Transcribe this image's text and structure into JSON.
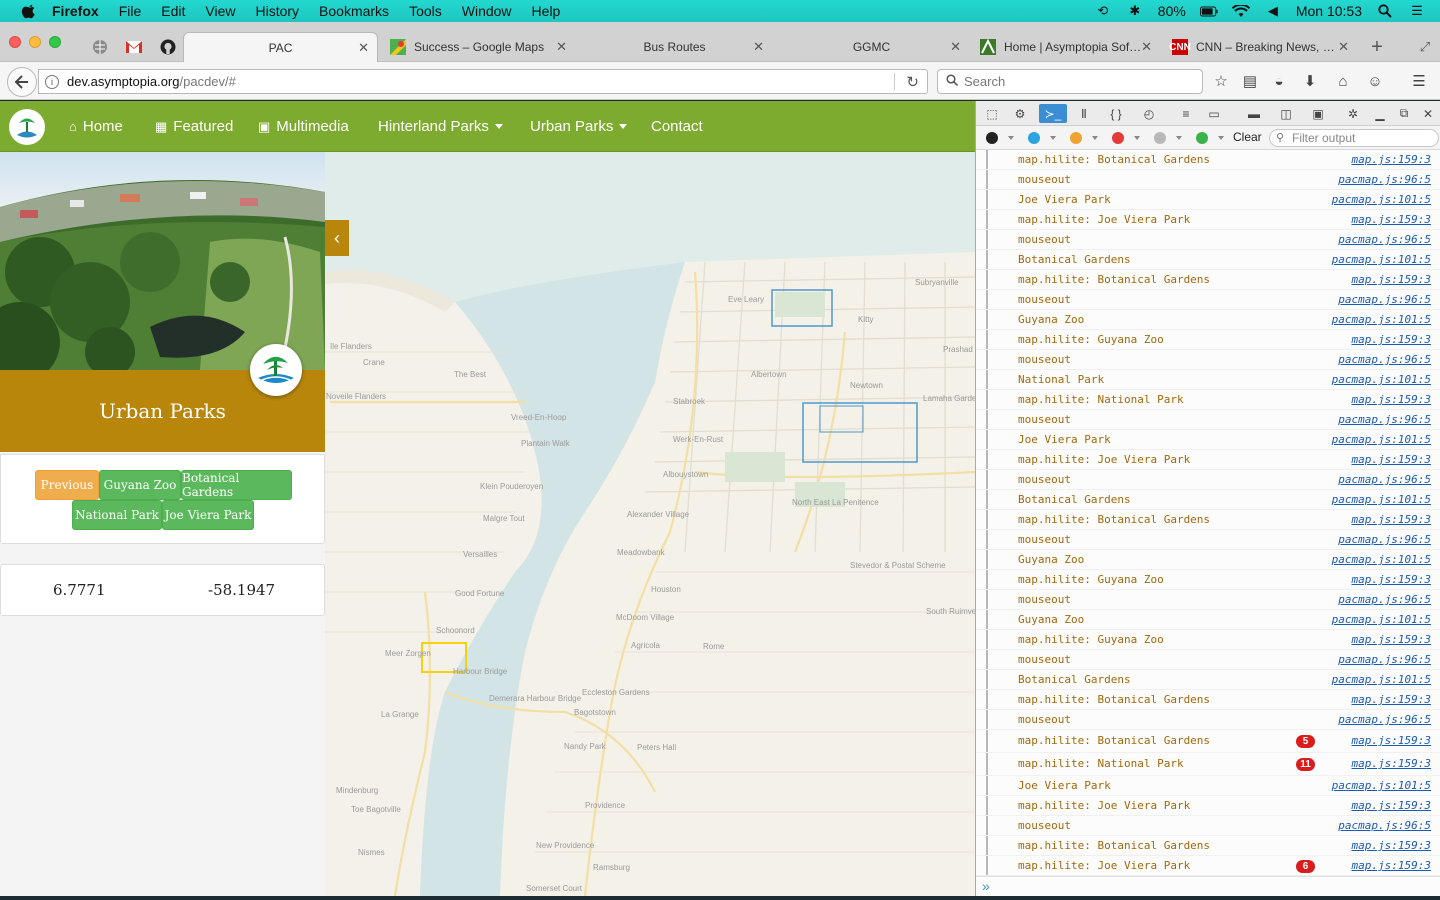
{
  "menubar": {
    "app": "Firefox",
    "items": [
      "File",
      "Edit",
      "View",
      "History",
      "Bookmarks",
      "Tools",
      "Window",
      "Help"
    ],
    "battery": "80%",
    "clock": "Mon 10:53"
  },
  "tabs": [
    {
      "title": "PAC",
      "active": true
    },
    {
      "title": "Success – Google Maps"
    },
    {
      "title": "Bus Routes"
    },
    {
      "title": "GGMC"
    },
    {
      "title": "Home | Asymptopia Sof…"
    },
    {
      "title": "CNN – Breaking News, …"
    }
  ],
  "urlbar": {
    "url_domain": "dev.asymptopia.org",
    "url_path": "/pacdev/#",
    "search_placeholder": "Search"
  },
  "site": {
    "nav": {
      "home": "Home",
      "featured": "Featured",
      "multimedia": "Multimedia",
      "hinterland": "Hinterland Parks",
      "urban": "Urban Parks",
      "contact": "Contact"
    },
    "panel_title": "Urban Parks",
    "buttons": {
      "previous": "Previous",
      "zoo": "Guyana Zoo",
      "botanical": "Botanical Gardens",
      "national": "National Park",
      "viera": "Joe Viera Park"
    },
    "coords": {
      "lat": "6.7771",
      "lng": "-58.1947"
    },
    "map_labels": [
      "Subryanville",
      "Eve Leary",
      "Kitty",
      "Prashad",
      "Albertown",
      "Newtown",
      "Stabroek",
      "Lamaha Gardens",
      "Werk-En-Rust",
      "Albouystown",
      "North East La Penitence",
      "Meadowbank",
      "Alexander Village",
      "McDoom Village",
      "Agricola",
      "Rome",
      "Houston",
      "South Ruimveldt",
      "Stevedor & Postal Scheme",
      "Ile Flanders",
      "Crane",
      "The Best",
      "Noveile Flanders",
      "Vreed-En-Hoop",
      "Plantain Walk",
      "Klein Pouderoyen",
      "Malgre Tout",
      "Versailles",
      "Good Fortune",
      "Schoonord",
      "Meer Zorgen",
      "Harbour Bridge",
      "Demerara Harbour Bridge",
      "Eccleston Gardens",
      "Bagotstown",
      "La Grange",
      "Nandy Park",
      "Peters Hall",
      "Providence",
      "Mindenburg",
      "Toe Bagotville",
      "Nismes",
      "New Providence",
      "Ramsburg",
      "Somerset Court"
    ]
  },
  "devtools": {
    "clear": "Clear",
    "filter_placeholder": "Filter output",
    "logs": [
      {
        "msg": "map.hilite: Botanical Gardens",
        "loc": "map.js:159:3"
      },
      {
        "msg": "mouseout",
        "loc": "pacmap.js:96:5"
      },
      {
        "msg": "Joe Viera Park",
        "loc": "pacmap.js:101:5"
      },
      {
        "msg": "map.hilite: Joe Viera Park",
        "loc": "map.js:159:3"
      },
      {
        "msg": "mouseout",
        "loc": "pacmap.js:96:5"
      },
      {
        "msg": "Botanical Gardens",
        "loc": "pacmap.js:101:5"
      },
      {
        "msg": "map.hilite: Botanical Gardens",
        "loc": "map.js:159:3"
      },
      {
        "msg": "mouseout",
        "loc": "pacmap.js:96:5"
      },
      {
        "msg": "Guyana Zoo",
        "loc": "pacmap.js:101:5"
      },
      {
        "msg": "map.hilite: Guyana Zoo",
        "loc": "map.js:159:3"
      },
      {
        "msg": "mouseout",
        "loc": "pacmap.js:96:5"
      },
      {
        "msg": "National Park",
        "loc": "pacmap.js:101:5"
      },
      {
        "msg": "map.hilite: National Park",
        "loc": "map.js:159:3"
      },
      {
        "msg": "mouseout",
        "loc": "pacmap.js:96:5"
      },
      {
        "msg": "Joe Viera Park",
        "loc": "pacmap.js:101:5"
      },
      {
        "msg": "map.hilite: Joe Viera Park",
        "loc": "map.js:159:3"
      },
      {
        "msg": "mouseout",
        "loc": "pacmap.js:96:5"
      },
      {
        "msg": "Botanical Gardens",
        "loc": "pacmap.js:101:5"
      },
      {
        "msg": "map.hilite: Botanical Gardens",
        "loc": "map.js:159:3"
      },
      {
        "msg": "mouseout",
        "loc": "pacmap.js:96:5"
      },
      {
        "msg": "Guyana Zoo",
        "loc": "pacmap.js:101:5"
      },
      {
        "msg": "map.hilite: Guyana Zoo",
        "loc": "map.js:159:3"
      },
      {
        "msg": "mouseout",
        "loc": "pacmap.js:96:5"
      },
      {
        "msg": "Guyana Zoo",
        "loc": "pacmap.js:101:5"
      },
      {
        "msg": "map.hilite: Guyana Zoo",
        "loc": "map.js:159:3"
      },
      {
        "msg": "mouseout",
        "loc": "pacmap.js:96:5"
      },
      {
        "msg": "Botanical Gardens",
        "loc": "pacmap.js:101:5"
      },
      {
        "msg": "map.hilite: Botanical Gardens",
        "loc": "map.js:159:3"
      },
      {
        "msg": "mouseout",
        "loc": "pacmap.js:96:5"
      },
      {
        "msg": "map.hilite: Botanical Gardens",
        "loc": "map.js:159:3",
        "count": "5"
      },
      {
        "msg": "map.hilite: National Park",
        "loc": "map.js:159:3",
        "count": "11"
      },
      {
        "msg": "Joe Viera Park",
        "loc": "pacmap.js:101:5"
      },
      {
        "msg": "map.hilite: Joe Viera Park",
        "loc": "map.js:159:3"
      },
      {
        "msg": "mouseout",
        "loc": "pacmap.js:96:5"
      },
      {
        "msg": "map.hilite: Botanical Gardens",
        "loc": "map.js:159:3"
      },
      {
        "msg": "map.hilite: Joe Viera Park",
        "loc": "map.js:159:3",
        "count": "6"
      }
    ]
  },
  "colors": {
    "site_green": "#7dab2f",
    "panel_gold": "#b8860b",
    "button_green": "#5cb85c",
    "button_orange": "#f0ad4e",
    "log_text": "#a1690a",
    "log_link": "#1b5ab3",
    "count_badge": "#d91c1c"
  }
}
